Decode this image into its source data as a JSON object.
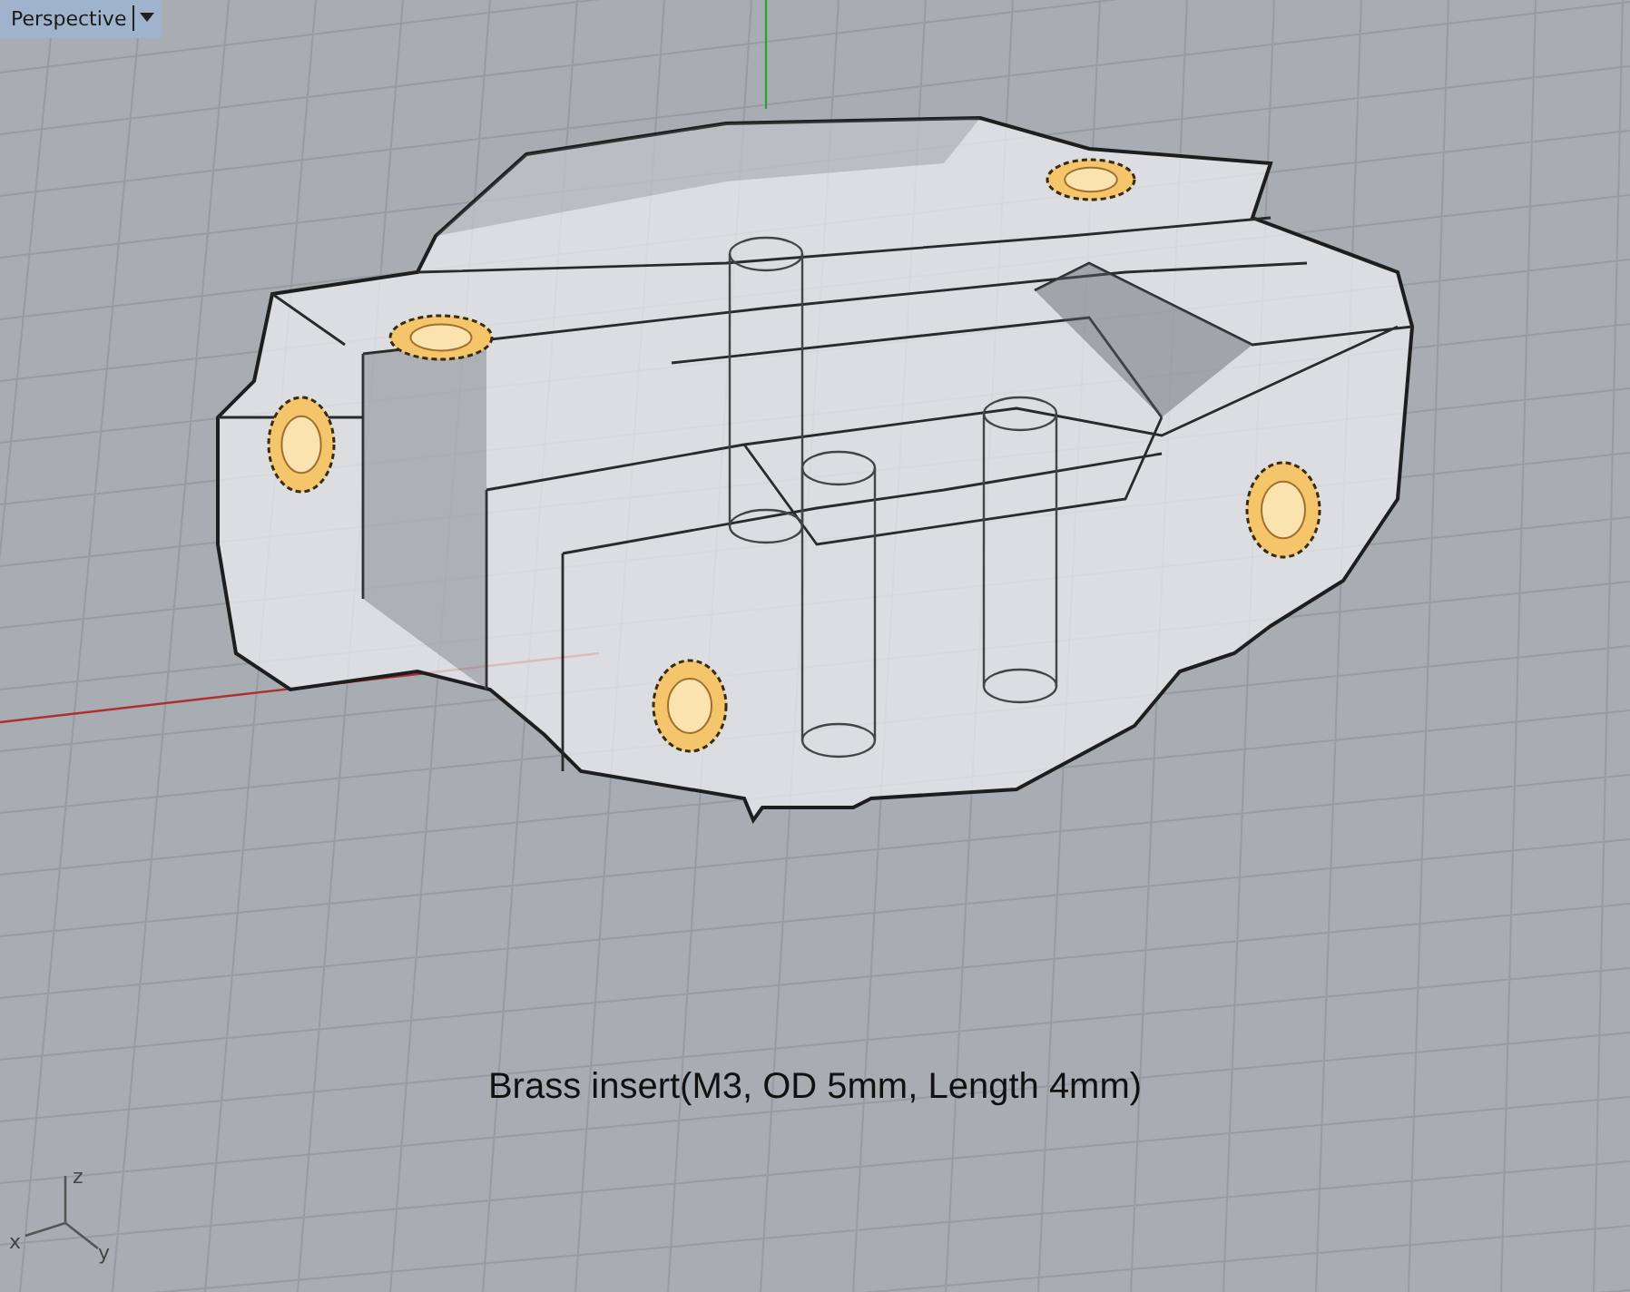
{
  "viewport": {
    "title": "Perspective"
  },
  "caption": "Brass insert(M3, OD 5mm, Length 4mm)",
  "axis_labels": [
    "z",
    "x",
    "y"
  ]
}
